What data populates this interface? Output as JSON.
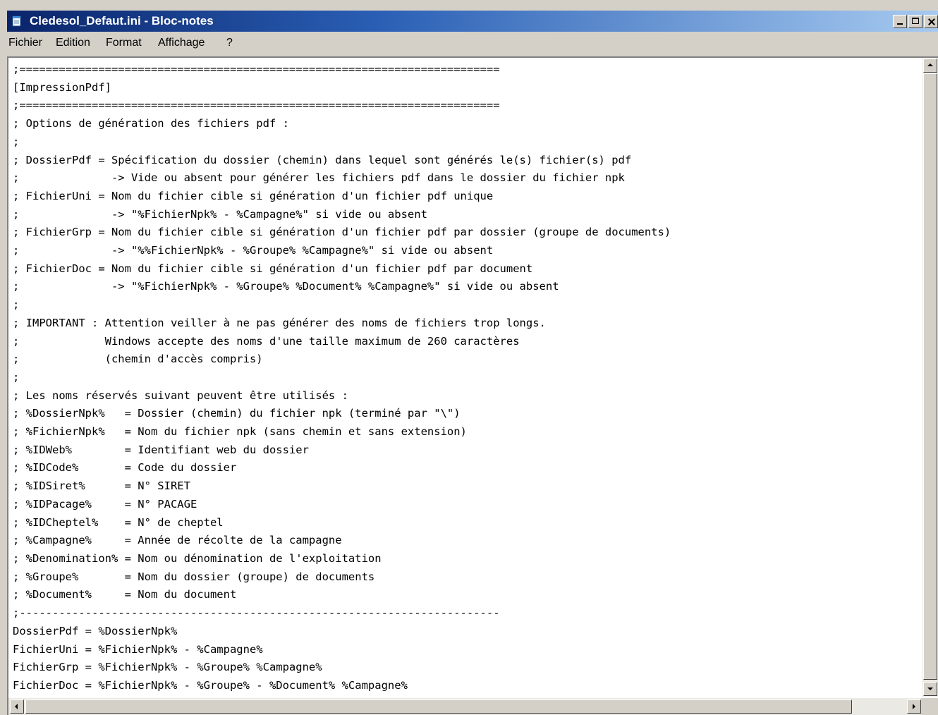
{
  "window": {
    "title": "Cledesol_Defaut.ini - Bloc-notes",
    "app_icon": "notepad-icon"
  },
  "menu": [
    "Fichier",
    "Edition",
    "Format",
    "Affichage",
    "?"
  ],
  "document": {
    "lines": [
      ";=========================================================================",
      "[ImpressionPdf]",
      ";=========================================================================",
      "; Options de génération des fichiers pdf :",
      ";",
      "; DossierPdf = Spécification du dossier (chemin) dans lequel sont générés le(s) fichier(s) pdf",
      ";              -> Vide ou absent pour générer les fichiers pdf dans le dossier du fichier npk",
      "; FichierUni = Nom du fichier cible si génération d'un fichier pdf unique",
      ";              -> \"%FichierNpk% - %Campagne%\" si vide ou absent",
      "; FichierGrp = Nom du fichier cible si génération d'un fichier pdf par dossier (groupe de documents)",
      ";              -> \"%%FichierNpk% - %Groupe% %Campagne%\" si vide ou absent",
      "; FichierDoc = Nom du fichier cible si génération d'un fichier pdf par document",
      ";              -> \"%FichierNpk% - %Groupe% %Document% %Campagne%\" si vide ou absent",
      ";",
      "; IMPORTANT : Attention veiller à ne pas générer des noms de fichiers trop longs.",
      ";             Windows accepte des noms d'une taille maximum de 260 caractères",
      ";             (chemin d'accès compris)",
      ";",
      "; Les noms réservés suivant peuvent être utilisés :",
      "; %DossierNpk%   = Dossier (chemin) du fichier npk (terminé par \"\\\")",
      "; %FichierNpk%   = Nom du fichier npk (sans chemin et sans extension)",
      "; %IDWeb%        = Identifiant web du dossier",
      "; %IDCode%       = Code du dossier",
      "; %IDSiret%      = N° SIRET",
      "; %IDPacage%     = N° PACAGE",
      "; %IDCheptel%    = N° de cheptel",
      "; %Campagne%     = Année de récolte de la campagne",
      "; %Denomination% = Nom ou dénomination de l'exploitation",
      "; %Groupe%       = Nom du dossier (groupe) de documents",
      "; %Document%     = Nom du document",
      ";-------------------------------------------------------------------------",
      "DossierPdf = %DossierNpk%",
      "FichierUni = %FichierNpk% - %Campagne%",
      "FichierGrp = %FichierNpk% - %Groupe% %Campagne%",
      "FichierDoc = %FichierNpk% - %Groupe% - %Document% %Campagne%"
    ]
  },
  "icons": {
    "minimize": "minimize-icon",
    "maximize": "maximize-icon",
    "close": "close-icon"
  }
}
